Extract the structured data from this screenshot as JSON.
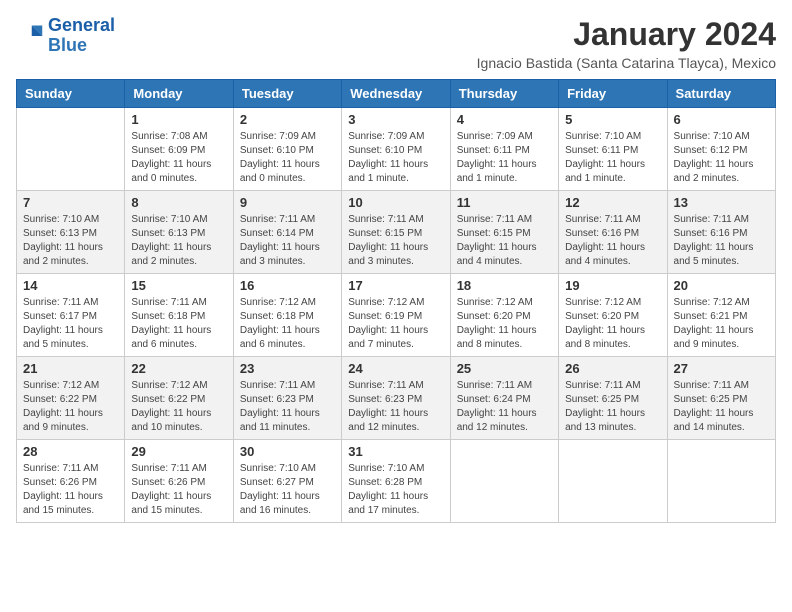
{
  "header": {
    "logo_line1": "General",
    "logo_line2": "Blue",
    "title": "January 2024",
    "subtitle": "Ignacio Bastida (Santa Catarina Tlayca), Mexico"
  },
  "days_of_week": [
    "Sunday",
    "Monday",
    "Tuesday",
    "Wednesday",
    "Thursday",
    "Friday",
    "Saturday"
  ],
  "weeks": [
    [
      {
        "day": "",
        "info": ""
      },
      {
        "day": "1",
        "info": "Sunrise: 7:08 AM\nSunset: 6:09 PM\nDaylight: 11 hours and 0 minutes."
      },
      {
        "day": "2",
        "info": "Sunrise: 7:09 AM\nSunset: 6:10 PM\nDaylight: 11 hours and 0 minutes."
      },
      {
        "day": "3",
        "info": "Sunrise: 7:09 AM\nSunset: 6:10 PM\nDaylight: 11 hours and 1 minute."
      },
      {
        "day": "4",
        "info": "Sunrise: 7:09 AM\nSunset: 6:11 PM\nDaylight: 11 hours and 1 minute."
      },
      {
        "day": "5",
        "info": "Sunrise: 7:10 AM\nSunset: 6:11 PM\nDaylight: 11 hours and 1 minute."
      },
      {
        "day": "6",
        "info": "Sunrise: 7:10 AM\nSunset: 6:12 PM\nDaylight: 11 hours and 2 minutes."
      }
    ],
    [
      {
        "day": "7",
        "info": "Sunrise: 7:10 AM\nSunset: 6:13 PM\nDaylight: 11 hours and 2 minutes."
      },
      {
        "day": "8",
        "info": "Sunrise: 7:10 AM\nSunset: 6:13 PM\nDaylight: 11 hours and 2 minutes."
      },
      {
        "day": "9",
        "info": "Sunrise: 7:11 AM\nSunset: 6:14 PM\nDaylight: 11 hours and 3 minutes."
      },
      {
        "day": "10",
        "info": "Sunrise: 7:11 AM\nSunset: 6:15 PM\nDaylight: 11 hours and 3 minutes."
      },
      {
        "day": "11",
        "info": "Sunrise: 7:11 AM\nSunset: 6:15 PM\nDaylight: 11 hours and 4 minutes."
      },
      {
        "day": "12",
        "info": "Sunrise: 7:11 AM\nSunset: 6:16 PM\nDaylight: 11 hours and 4 minutes."
      },
      {
        "day": "13",
        "info": "Sunrise: 7:11 AM\nSunset: 6:16 PM\nDaylight: 11 hours and 5 minutes."
      }
    ],
    [
      {
        "day": "14",
        "info": "Sunrise: 7:11 AM\nSunset: 6:17 PM\nDaylight: 11 hours and 5 minutes."
      },
      {
        "day": "15",
        "info": "Sunrise: 7:11 AM\nSunset: 6:18 PM\nDaylight: 11 hours and 6 minutes."
      },
      {
        "day": "16",
        "info": "Sunrise: 7:12 AM\nSunset: 6:18 PM\nDaylight: 11 hours and 6 minutes."
      },
      {
        "day": "17",
        "info": "Sunrise: 7:12 AM\nSunset: 6:19 PM\nDaylight: 11 hours and 7 minutes."
      },
      {
        "day": "18",
        "info": "Sunrise: 7:12 AM\nSunset: 6:20 PM\nDaylight: 11 hours and 8 minutes."
      },
      {
        "day": "19",
        "info": "Sunrise: 7:12 AM\nSunset: 6:20 PM\nDaylight: 11 hours and 8 minutes."
      },
      {
        "day": "20",
        "info": "Sunrise: 7:12 AM\nSunset: 6:21 PM\nDaylight: 11 hours and 9 minutes."
      }
    ],
    [
      {
        "day": "21",
        "info": "Sunrise: 7:12 AM\nSunset: 6:22 PM\nDaylight: 11 hours and 9 minutes."
      },
      {
        "day": "22",
        "info": "Sunrise: 7:12 AM\nSunset: 6:22 PM\nDaylight: 11 hours and 10 minutes."
      },
      {
        "day": "23",
        "info": "Sunrise: 7:11 AM\nSunset: 6:23 PM\nDaylight: 11 hours and 11 minutes."
      },
      {
        "day": "24",
        "info": "Sunrise: 7:11 AM\nSunset: 6:23 PM\nDaylight: 11 hours and 12 minutes."
      },
      {
        "day": "25",
        "info": "Sunrise: 7:11 AM\nSunset: 6:24 PM\nDaylight: 11 hours and 12 minutes."
      },
      {
        "day": "26",
        "info": "Sunrise: 7:11 AM\nSunset: 6:25 PM\nDaylight: 11 hours and 13 minutes."
      },
      {
        "day": "27",
        "info": "Sunrise: 7:11 AM\nSunset: 6:25 PM\nDaylight: 11 hours and 14 minutes."
      }
    ],
    [
      {
        "day": "28",
        "info": "Sunrise: 7:11 AM\nSunset: 6:26 PM\nDaylight: 11 hours and 15 minutes."
      },
      {
        "day": "29",
        "info": "Sunrise: 7:11 AM\nSunset: 6:26 PM\nDaylight: 11 hours and 15 minutes."
      },
      {
        "day": "30",
        "info": "Sunrise: 7:10 AM\nSunset: 6:27 PM\nDaylight: 11 hours and 16 minutes."
      },
      {
        "day": "31",
        "info": "Sunrise: 7:10 AM\nSunset: 6:28 PM\nDaylight: 11 hours and 17 minutes."
      },
      {
        "day": "",
        "info": ""
      },
      {
        "day": "",
        "info": ""
      },
      {
        "day": "",
        "info": ""
      }
    ]
  ]
}
